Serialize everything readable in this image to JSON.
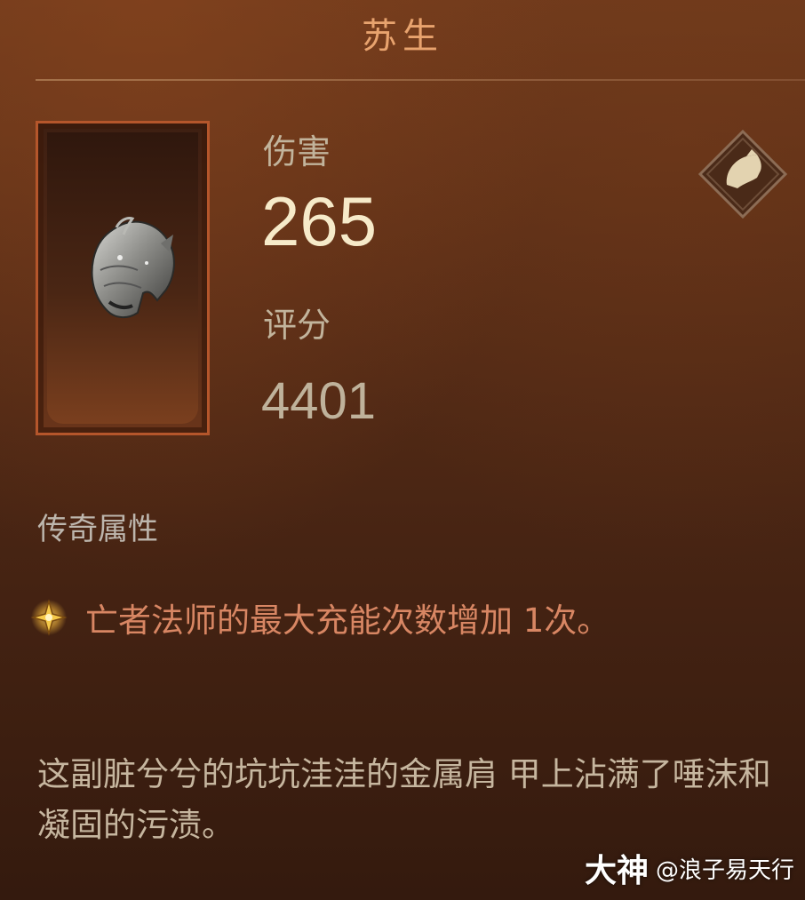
{
  "item": {
    "name": "苏生",
    "icon": "shoulder-armor-helm-icon",
    "slot_icon": "shoulder-slot-icon"
  },
  "stats": {
    "damage_label": "伤害",
    "damage_value": "265",
    "score_label": "评分",
    "score_value": "4401"
  },
  "legendary": {
    "section_label": "传奇属性",
    "bullet_icon": "legendary-star-icon",
    "affix": "亡者法师的最大充能次数增加 1次。"
  },
  "flavor_text": "这副脏兮兮的坑坑洼洼的金属肩 甲上沾满了唾沫和凝固的污渍。",
  "watermark": {
    "logo": "大神",
    "user": "@浪子易天行"
  },
  "colors": {
    "title": "#e8a36e",
    "affix": "#d88663",
    "frame": "#b5562b",
    "value_highlight": "#f6eac9"
  }
}
